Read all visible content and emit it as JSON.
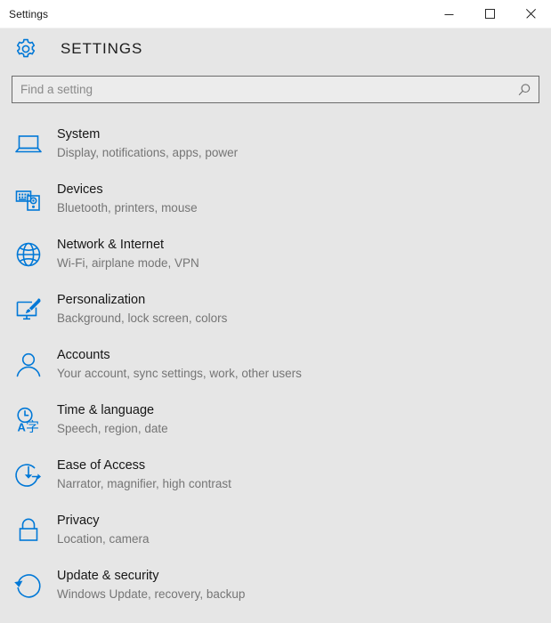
{
  "window": {
    "titlebar_title": "Settings",
    "controls": [
      {
        "name": "minimize-button",
        "label": "Minimize"
      },
      {
        "name": "maximize-button",
        "label": "Maximize"
      },
      {
        "name": "close-button",
        "label": "Close"
      }
    ]
  },
  "header": {
    "title": "SETTINGS",
    "gear_icon": "gear-icon"
  },
  "search": {
    "placeholder": "Find a setting",
    "value": "",
    "icon": "search-icon"
  },
  "colors": {
    "accent": "#0078d7",
    "window_background": "#e6e6e6",
    "titlebar_background": "#ffffff",
    "title_text": "#161616",
    "subtitle_text": "#757575",
    "search_border": "#6b6b6b",
    "search_background": "#ececec"
  },
  "categories": [
    {
      "icon": "monitor-icon",
      "title": "System",
      "subtitle": "Display, notifications, apps, power"
    },
    {
      "icon": "devices-icon",
      "title": "Devices",
      "subtitle": "Bluetooth, printers, mouse"
    },
    {
      "icon": "globe-icon",
      "title": "Network & Internet",
      "subtitle": "Wi-Fi, airplane mode, VPN"
    },
    {
      "icon": "paintbrush-monitor-icon",
      "title": "Personalization",
      "subtitle": "Background, lock screen, colors"
    },
    {
      "icon": "person-icon",
      "title": "Accounts",
      "subtitle": "Your account, sync settings, work, other users"
    },
    {
      "icon": "clock-language-icon",
      "title": "Time & language",
      "subtitle": "Speech, region, date"
    },
    {
      "icon": "ease-of-access-icon",
      "title": "Ease of Access",
      "subtitle": "Narrator, magnifier, high contrast"
    },
    {
      "icon": "lock-icon",
      "title": "Privacy",
      "subtitle": "Location, camera"
    },
    {
      "icon": "refresh-icon",
      "title": "Update & security",
      "subtitle": "Windows Update, recovery, backup"
    }
  ]
}
